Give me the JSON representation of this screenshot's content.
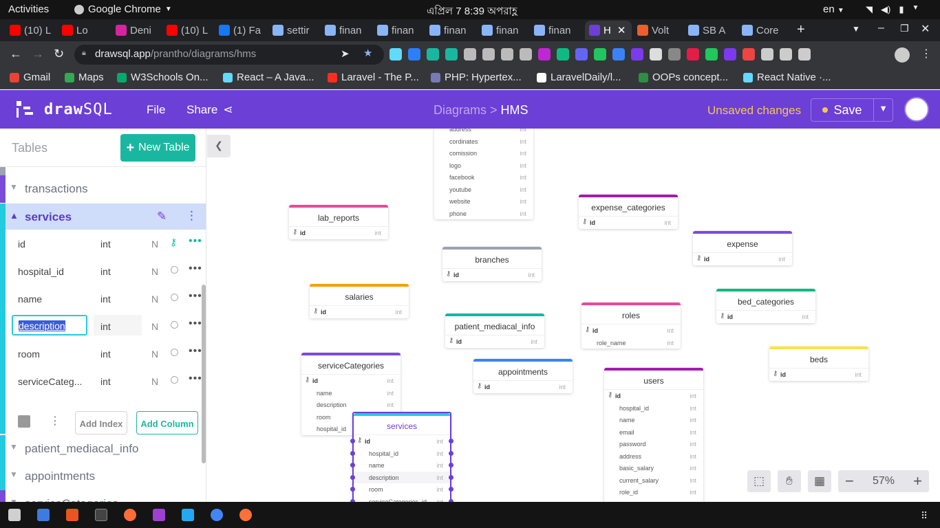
{
  "os": {
    "activities": "Activities",
    "app": "Google Chrome",
    "clock": "এপ্রিল 7  8:39 অপরাহ্ণ",
    "lang": "en"
  },
  "tabs": [
    {
      "label": "(10) L",
      "color": "#ff0000"
    },
    {
      "label": "Lo",
      "color": "#ff0000"
    },
    {
      "label": "Deni",
      "color": "#d6249f"
    },
    {
      "label": "(10) L",
      "color": "#ff0000"
    },
    {
      "label": "(1) Fa",
      "color": "#1877f2"
    },
    {
      "label": "settir",
      "color": "#8ab4f8"
    },
    {
      "label": "finan",
      "color": "#8ab4f8"
    },
    {
      "label": "finan",
      "color": "#8ab4f8"
    },
    {
      "label": "finan",
      "color": "#8ab4f8"
    },
    {
      "label": "finan",
      "color": "#8ab4f8"
    },
    {
      "label": "finan",
      "color": "#8ab4f8"
    },
    {
      "label": "H",
      "color": "#6c3fd6"
    },
    {
      "label": "Volt",
      "color": "#e8612c"
    },
    {
      "label": "SB A",
      "color": "#8ab4f8"
    },
    {
      "label": "Core",
      "color": "#8ab4f8"
    }
  ],
  "url": {
    "host": "drawsql.app",
    "path": "/prantho/diagrams/hms"
  },
  "bookmarks": [
    {
      "label": "Gmail",
      "color": "#ea4335"
    },
    {
      "label": "Maps",
      "color": "#34a853"
    },
    {
      "label": "W3Schools On...",
      "color": "#04aa6d"
    },
    {
      "label": "React – A Java...",
      "color": "#61dafb"
    },
    {
      "label": "Laravel - The P...",
      "color": "#ff2d20"
    },
    {
      "label": "PHP: Hypertex...",
      "color": "#777bb3"
    },
    {
      "label": "LaravelDaily/l...",
      "color": "#ffffff"
    },
    {
      "label": "OOPs concept...",
      "color": "#2f8d46"
    },
    {
      "label": "React Native ·...",
      "color": "#61dafb"
    }
  ],
  "header": {
    "brand_a": "draw",
    "brand_b": "SQL",
    "file": "File",
    "share": "Share",
    "crumb_a": "Diagrams >",
    "crumb_b": "HMS",
    "unsaved": "Unsaved changes",
    "save": "Save"
  },
  "sidebar": {
    "title": "Tables",
    "new_table": "New Table",
    "above": [
      {
        "name": "transactions",
        "color": "#7c4ad9"
      }
    ],
    "current": {
      "name": "services",
      "columns": [
        {
          "name": "id",
          "type": "int",
          "null": "N",
          "key": true
        },
        {
          "name": "hospital_id",
          "type": "int",
          "null": "N",
          "key": false
        },
        {
          "name": "name",
          "type": "int",
          "null": "N",
          "key": false
        },
        {
          "name": "description",
          "type": "int",
          "null": "N",
          "key": false,
          "editing": true
        },
        {
          "name": "room",
          "type": "int",
          "null": "N",
          "key": false
        },
        {
          "name": "serviceCateg...",
          "type": "int",
          "null": "N",
          "key": false
        }
      ],
      "add_index": "Add Index",
      "add_column": "Add Column"
    },
    "below": [
      {
        "name": "patient_mediacal_info",
        "color": "#22cbe0"
      },
      {
        "name": "appointments",
        "color": "#22cbe0"
      },
      {
        "name": "serviceCategories",
        "color": "#7c4ad9"
      }
    ]
  },
  "diagram": {
    "tables": [
      {
        "name": "",
        "color": "#cccccc",
        "cols": [
          "address",
          "cordinates",
          "comission",
          "logo",
          "facebook",
          "youtube",
          "website",
          "phone"
        ],
        "pk": false,
        "noheader": true
      },
      {
        "name": "lab_reports",
        "color": "#ec4899",
        "cols": [
          "id"
        ],
        "pk": true
      },
      {
        "name": "expense_categories",
        "color": "#a21caf",
        "cols": [
          "id"
        ],
        "pk": true
      },
      {
        "name": "expense",
        "color": "#7c4ad9",
        "cols": [
          "id"
        ],
        "pk": true
      },
      {
        "name": "branches",
        "color": "#9ca3af",
        "cols": [
          "id"
        ],
        "pk": true
      },
      {
        "name": "salaries",
        "color": "#f59e0b",
        "cols": [
          "id"
        ],
        "pk": true
      },
      {
        "name": "patient_mediacal_info",
        "color": "#14b8a6",
        "cols": [
          "id"
        ],
        "pk": true
      },
      {
        "name": "roles",
        "color": "#ec4899",
        "cols": [
          "id",
          "role_name"
        ],
        "pk": true
      },
      {
        "name": "bed_categories",
        "color": "#10b981",
        "cols": [
          "id"
        ],
        "pk": true
      },
      {
        "name": "beds",
        "color": "#fde047",
        "cols": [
          "id"
        ],
        "pk": true
      },
      {
        "name": "serviceCategories",
        "color": "#7c4ad9",
        "cols": [
          "id",
          "name",
          "description",
          "room",
          "hospital_id"
        ],
        "pk": true
      },
      {
        "name": "appointments",
        "color": "#3b82f6",
        "cols": [
          "id"
        ],
        "pk": true
      },
      {
        "name": "users",
        "color": "#a21caf",
        "cols": [
          "id",
          "hospital_id",
          "name",
          "email",
          "password",
          "address",
          "basic_salary",
          "current_salary",
          "role_id",
          "..."
        ],
        "pk": true
      },
      {
        "name": "services",
        "color": "#22cbe0",
        "cols": [
          "id",
          "hospital_id",
          "name",
          "description",
          "room",
          "serviceCategories_id"
        ],
        "pk": true,
        "selected": true
      }
    ],
    "type_label": "int",
    "zoom": "57%"
  }
}
